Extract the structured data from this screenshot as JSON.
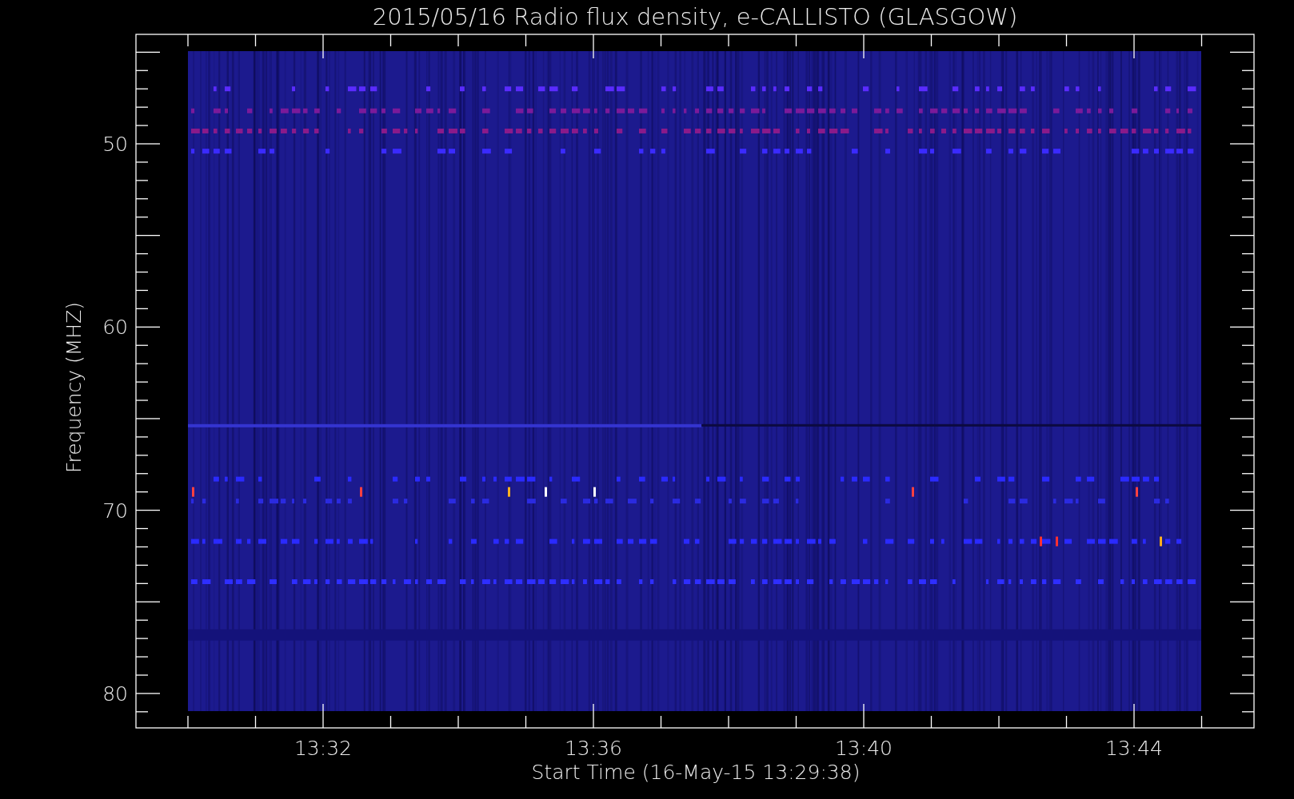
{
  "title": "2015/05/16  Radio flux density, e-CALLISTO (GLASGOW)",
  "y_axis": {
    "label": "Frequency (MHZ)",
    "ticks": [
      "50",
      "60",
      "70",
      "80"
    ]
  },
  "x_axis": {
    "label": "Start Time (16-May-15 13:29:38)",
    "ticks": [
      "13:32",
      "13:36",
      "13:40",
      "13:44"
    ]
  }
}
